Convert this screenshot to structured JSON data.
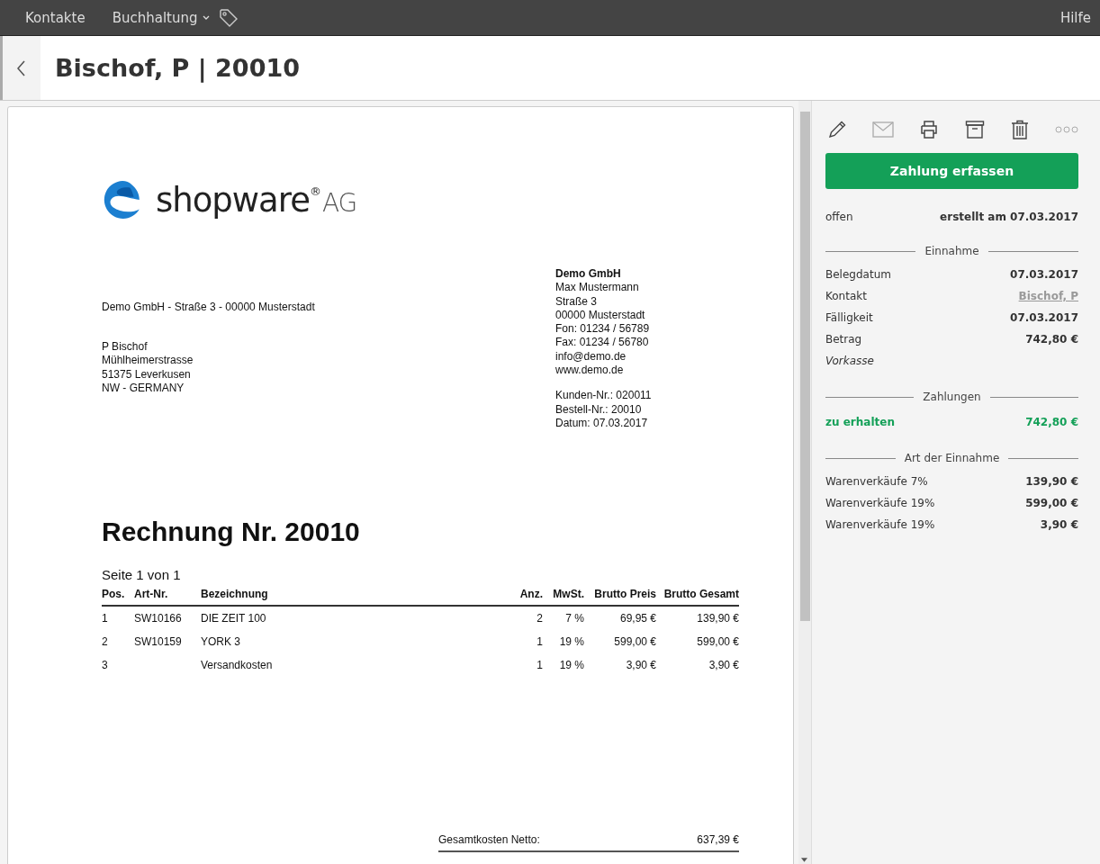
{
  "nav": {
    "items": [
      {
        "label": "Kontakte",
        "dropdown": false
      },
      {
        "label": "Buchhaltung",
        "dropdown": true
      }
    ],
    "help": "Hilfe"
  },
  "header": {
    "title": "Bischof, P | 20010"
  },
  "document": {
    "logo": {
      "name": "shopware",
      "mark": "®",
      "suffix": "AG"
    },
    "sender_line": "Demo GmbH - Straße 3 - 00000 Musterstadt",
    "recipient": [
      "P Bischof",
      "Mühlheimerstrasse",
      "51375 Leverkusen",
      "NW - GERMANY"
    ],
    "company": {
      "name": "Demo GmbH",
      "lines": [
        "Max Mustermann",
        "Straße 3",
        "00000 Musterstadt",
        "Fon: 01234 / 56789",
        "Fax: 01234 / 56780",
        "info@demo.de",
        "www.demo.de"
      ],
      "refs": [
        "Kunden-Nr.: 020011",
        "Bestell-Nr.: 20010",
        "Datum: 07.03.2017"
      ]
    },
    "title": "Rechnung Nr. 20010",
    "page": "Seite 1 von 1",
    "columns": [
      "Pos.",
      "Art-Nr.",
      "Bezeichnung",
      "Anz.",
      "MwSt.",
      "Brutto Preis",
      "Brutto Gesamt"
    ],
    "rows": [
      [
        "1",
        "SW10166",
        "DIE ZEIT 100",
        "2",
        "7 %",
        "69,95 €",
        "139,90 €"
      ],
      [
        "2",
        "SW10159",
        "YORK 3",
        "1",
        "19 %",
        "599,00 €",
        "599,00 €"
      ],
      [
        "3",
        "",
        "Versandkosten",
        "1",
        "19 %",
        "3,90 €",
        "3,90 €"
      ]
    ],
    "totals": [
      {
        "label": "Gesamtkosten Netto:",
        "value": "637,39 €"
      }
    ]
  },
  "toolbar": [
    {
      "kind": "edit",
      "disabled": false
    },
    {
      "kind": "mail",
      "disabled": true
    },
    {
      "kind": "print",
      "disabled": false
    },
    {
      "kind": "archive",
      "disabled": false
    },
    {
      "kind": "delete",
      "disabled": false
    },
    {
      "kind": "more",
      "disabled": true
    }
  ],
  "primary_button": "Zahlung erfassen",
  "status": {
    "state": "offen",
    "created": "erstellt am 07.03.2017"
  },
  "sections": [
    {
      "title": "Einnahme",
      "rows": [
        {
          "kind": "value",
          "label": "Belegdatum",
          "value": "07.03.2017"
        },
        {
          "kind": "link",
          "label": "Kontakt",
          "value": "Bischof, P"
        },
        {
          "kind": "value",
          "label": "Fälligkeit",
          "value": "07.03.2017"
        },
        {
          "kind": "value",
          "label": "Betrag",
          "value": "742,80 €"
        },
        {
          "kind": "note",
          "label": "Vorkasse"
        }
      ]
    },
    {
      "title": "Zahlungen",
      "rows": [
        {
          "kind": "highlight",
          "label": "zu erhalten",
          "value": "742,80 €"
        }
      ]
    },
    {
      "title": "Art der Einnahme",
      "rows": [
        {
          "kind": "plain",
          "label": "Warenverkäufe 7%",
          "value": "139,90 €"
        },
        {
          "kind": "plain",
          "label": "Warenverkäufe 19%",
          "value": "599,00 €"
        },
        {
          "kind": "plain",
          "label": "Warenverkäufe 19%",
          "value": "3,90 €"
        }
      ]
    }
  ]
}
